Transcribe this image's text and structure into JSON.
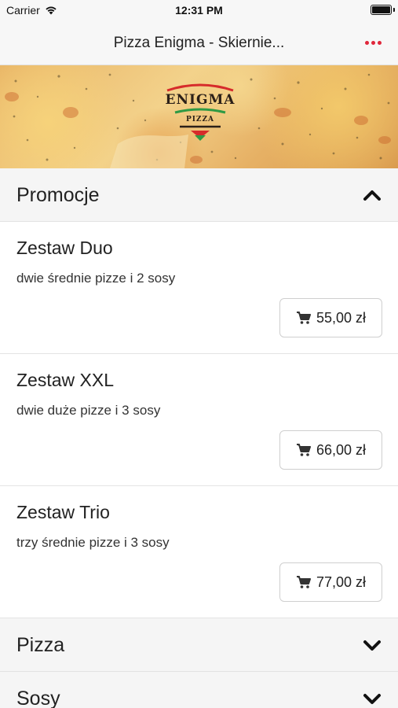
{
  "status_bar": {
    "carrier": "Carrier",
    "time": "12:31 PM"
  },
  "nav": {
    "title": "Pizza Enigma - Skiernie..."
  },
  "banner": {
    "logo_text": "ENIGMA",
    "logo_sub": "PIZZA"
  },
  "sections": [
    {
      "title": "Promocje",
      "expanded": true
    },
    {
      "title": "Pizza",
      "expanded": false
    },
    {
      "title": "Sosy",
      "expanded": false
    }
  ],
  "items": [
    {
      "name": "Zestaw Duo",
      "description": "dwie średnie pizze i 2 sosy",
      "price": "55,00 zł"
    },
    {
      "name": "Zestaw XXL",
      "description": "dwie duże pizze i 3 sosy",
      "price": "66,00 zł"
    },
    {
      "name": "Zestaw Trio",
      "description": "trzy średnie pizze i 3 sosy",
      "price": "77,00 zł"
    }
  ],
  "colors": {
    "accent": "#e0263a",
    "header_bg": "#f5f5f5"
  }
}
